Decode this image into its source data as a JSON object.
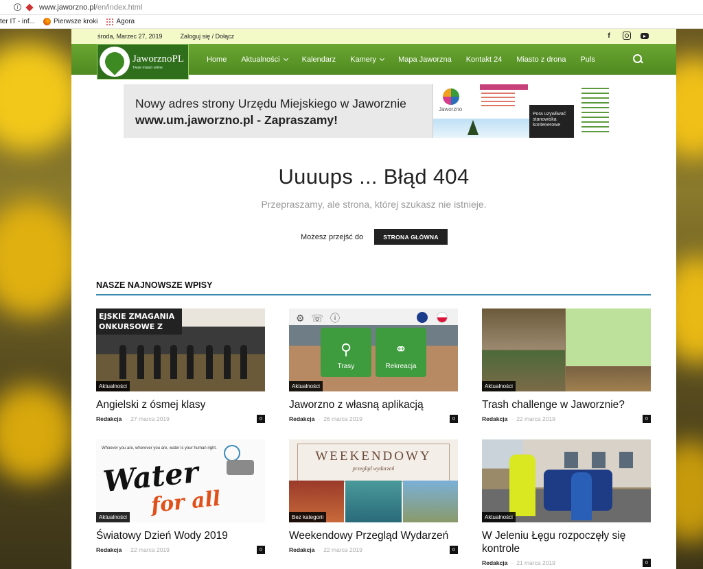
{
  "browser": {
    "url_main": "www.jaworzno.pl",
    "url_rest": "/en/index.html",
    "bookmarks": [
      "ter IT - inf...",
      "Pierwsze kroki",
      "Agora"
    ]
  },
  "topbar": {
    "date": "środa, Marzec 27, 2019",
    "login": "Zaloguj się / Dołącz",
    "social_icons": [
      "facebook-icon",
      "instagram-icon",
      "youtube-icon"
    ]
  },
  "logo": {
    "name": "JaworznoPL",
    "tagline": "Twoje miasto online"
  },
  "menu": {
    "items": [
      {
        "label": "Home",
        "dropdown": false
      },
      {
        "label": "Aktualności",
        "dropdown": true
      },
      {
        "label": "Kalendarz",
        "dropdown": false
      },
      {
        "label": "Kamery",
        "dropdown": true
      },
      {
        "label": "Mapa Jaworzna",
        "dropdown": false
      },
      {
        "label": "Kontakt 24",
        "dropdown": false
      },
      {
        "label": "Miasto z drona",
        "dropdown": false
      },
      {
        "label": "Puls",
        "dropdown": false
      }
    ]
  },
  "banner": {
    "line1": "Nowy adres strony Urzędu Miejskiego w Jaworznie",
    "line2": "www.um.jaworzno.pl - Zapraszamy!",
    "screenshot_logo": "Jaworzno",
    "screenshot_caption": "Pora uzywliwać stanowiska kontenerowe"
  },
  "error": {
    "title": "Uuuups ... Błąd 404",
    "subtitle": "Przepraszamy, ale strona, której szukasz nie istnieje.",
    "go_text": "Możesz przejść do",
    "home_button": "STRONA GŁÓWNA"
  },
  "posts": {
    "section_title": "NASZE NAJNOWSZE WPISY",
    "items": [
      {
        "category": "Aktualności",
        "title": "Angielski z ósmej klasy",
        "author": "Redakcja",
        "date": "27 marca 2019",
        "comments": "0",
        "thumb_text": "EJSKIE ZMAGANIA\nONKURSOWE Z"
      },
      {
        "category": "Aktualności",
        "title": "Jaworzno z własną aplikacją",
        "author": "Redakcja",
        "date": "26 marca 2019",
        "comments": "0",
        "tile1": "Trasy",
        "tile2": "Rekreacja"
      },
      {
        "category": "Aktualności",
        "title": "Trash challenge w Jaworznie?",
        "author": "Redakcja",
        "date": "22 marca 2019",
        "comments": "0"
      },
      {
        "category": "Aktualności",
        "title": "Światowy Dzień Wody 2019",
        "author": "Redakcja",
        "date": "22 marca 2019",
        "comments": "0",
        "thumb_top": "Whoever you are, wherever you are, water is your human right.",
        "thumb_big": "Water",
        "thumb_big2": "for all"
      },
      {
        "category": "Bez kategorii",
        "title": "Weekendowy Przegląd Wydarzeń",
        "author": "Redakcja",
        "date": "22 marca 2019",
        "comments": "0",
        "thumb_big": "WEEKENDOWY",
        "thumb_sub": "przegląd wydarzeń"
      },
      {
        "category": "Aktualności",
        "title": "W Jeleniu Łęgu rozpoczęły się kontrole",
        "author": "Redakcja",
        "date": "21 marca 2019",
        "comments": "0"
      }
    ]
  }
}
